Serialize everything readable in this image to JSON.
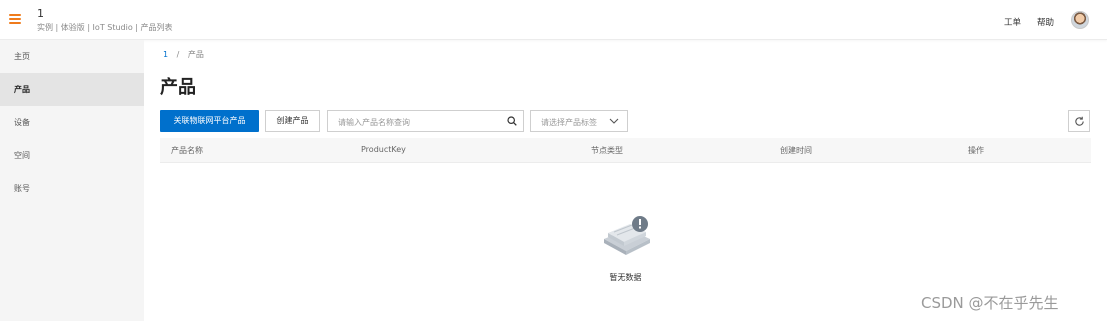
{
  "header": {
    "title": "1",
    "subtitle": "实例 | 体验版 | IoT Studio | 产品列表",
    "links": {
      "ticket": "工单",
      "help": "帮助"
    }
  },
  "sidebar": {
    "items": [
      {
        "label": "主页",
        "active": false
      },
      {
        "label": "产品",
        "active": true
      },
      {
        "label": "设备",
        "active": false
      },
      {
        "label": "空间",
        "active": false
      },
      {
        "label": "账号",
        "active": false
      }
    ]
  },
  "breadcrumb": {
    "root": "1",
    "separator": "/",
    "current": "产品"
  },
  "page": {
    "title": "产品"
  },
  "toolbar": {
    "link_product_label": "关联物联网平台产品",
    "create_product_label": "创建产品",
    "search_placeholder": "请输入产品名称查询",
    "tag_select_placeholder": "请选择产品标签"
  },
  "table": {
    "columns": [
      "产品名称",
      "ProductKey",
      "节点类型",
      "创建时间",
      "操作"
    ],
    "rows": []
  },
  "empty_state": {
    "text": "暂无数据"
  },
  "watermark": "CSDN @不在乎先生",
  "colors": {
    "accent": "#0070cc",
    "menu_icon": "#ef7b1c",
    "sidebar_bg": "#f5f5f5",
    "sidebar_active": "#e4e4e4"
  }
}
